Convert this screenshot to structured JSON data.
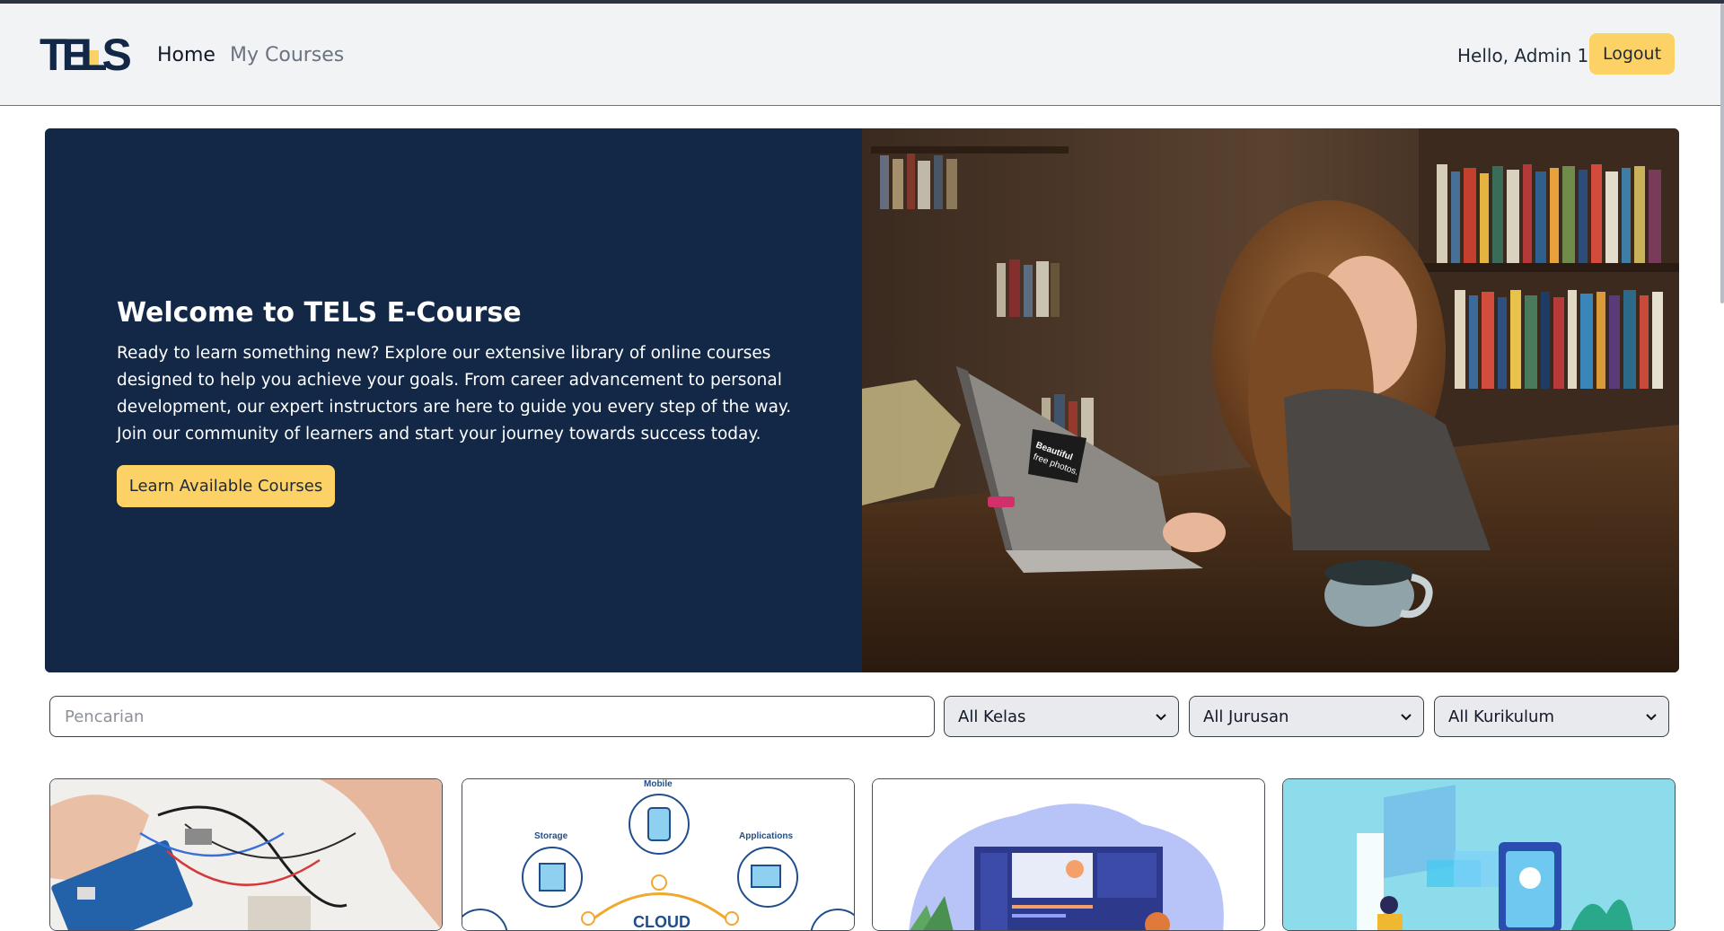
{
  "brand": {
    "logo_text": "TELS",
    "accent": "#fcd166",
    "navy": "#132847"
  },
  "nav": {
    "home_label": "Home",
    "courses_label": "My Courses"
  },
  "user": {
    "greeting": "Hello, Admin 1",
    "logout_label": "Logout"
  },
  "hero": {
    "title": "Welcome to TELS E-Course",
    "text": "Ready to learn something new? Explore our extensive library of online courses designed to help you achieve your goals. From career advancement to personal development, our expert instructors are here to guide you every step of the way. Join our community of learners and start your journey towards success today.",
    "button_label": "Learn Available Courses",
    "photo_sticker": "Beautiful free photos."
  },
  "filters": {
    "search_placeholder": "Pencarian",
    "kelas": "All Kelas",
    "jurusan": "All Jurusan",
    "kurikulum": "All Kurikulum"
  },
  "cards": {
    "cloud_labels": {
      "mobile": "Mobile",
      "storage": "Storage",
      "applications": "Applications",
      "cloud": "CLOUD"
    }
  }
}
